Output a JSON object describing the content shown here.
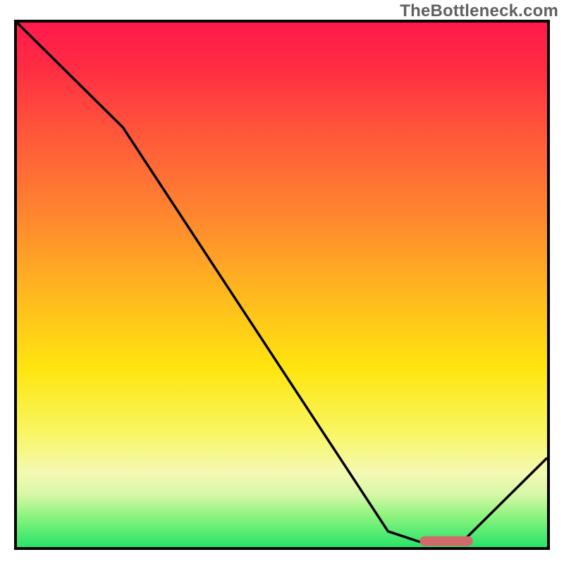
{
  "watermark": "TheBottleneck.com",
  "colors": {
    "border": "#000000",
    "line": "#000000",
    "marker": "#d16a6a",
    "gradient_top": "#ff1a4b",
    "gradient_bottom": "#28e36a"
  },
  "chart_data": {
    "type": "line",
    "title": "",
    "xlabel": "",
    "ylabel": "",
    "xlim": [
      0,
      100
    ],
    "ylim": [
      0,
      100
    ],
    "grid": false,
    "legend": false,
    "series": [
      {
        "name": "bottleneck-curve",
        "x": [
          0,
          20,
          70,
          76,
          84,
          100
        ],
        "values": [
          100,
          80,
          3,
          1,
          1,
          17
        ]
      }
    ],
    "annotations": [
      {
        "name": "optimal-marker",
        "shape": "rounded-bar",
        "x_range": [
          76,
          86
        ],
        "y": 1
      }
    ],
    "gradient_stops": [
      {
        "pos": 0,
        "color": "#ff1a4b"
      },
      {
        "pos": 22,
        "color": "#ff5a3a"
      },
      {
        "pos": 52,
        "color": "#ffb91f"
      },
      {
        "pos": 78,
        "color": "#f4f9b4"
      },
      {
        "pos": 100,
        "color": "#28e36a"
      }
    ]
  }
}
